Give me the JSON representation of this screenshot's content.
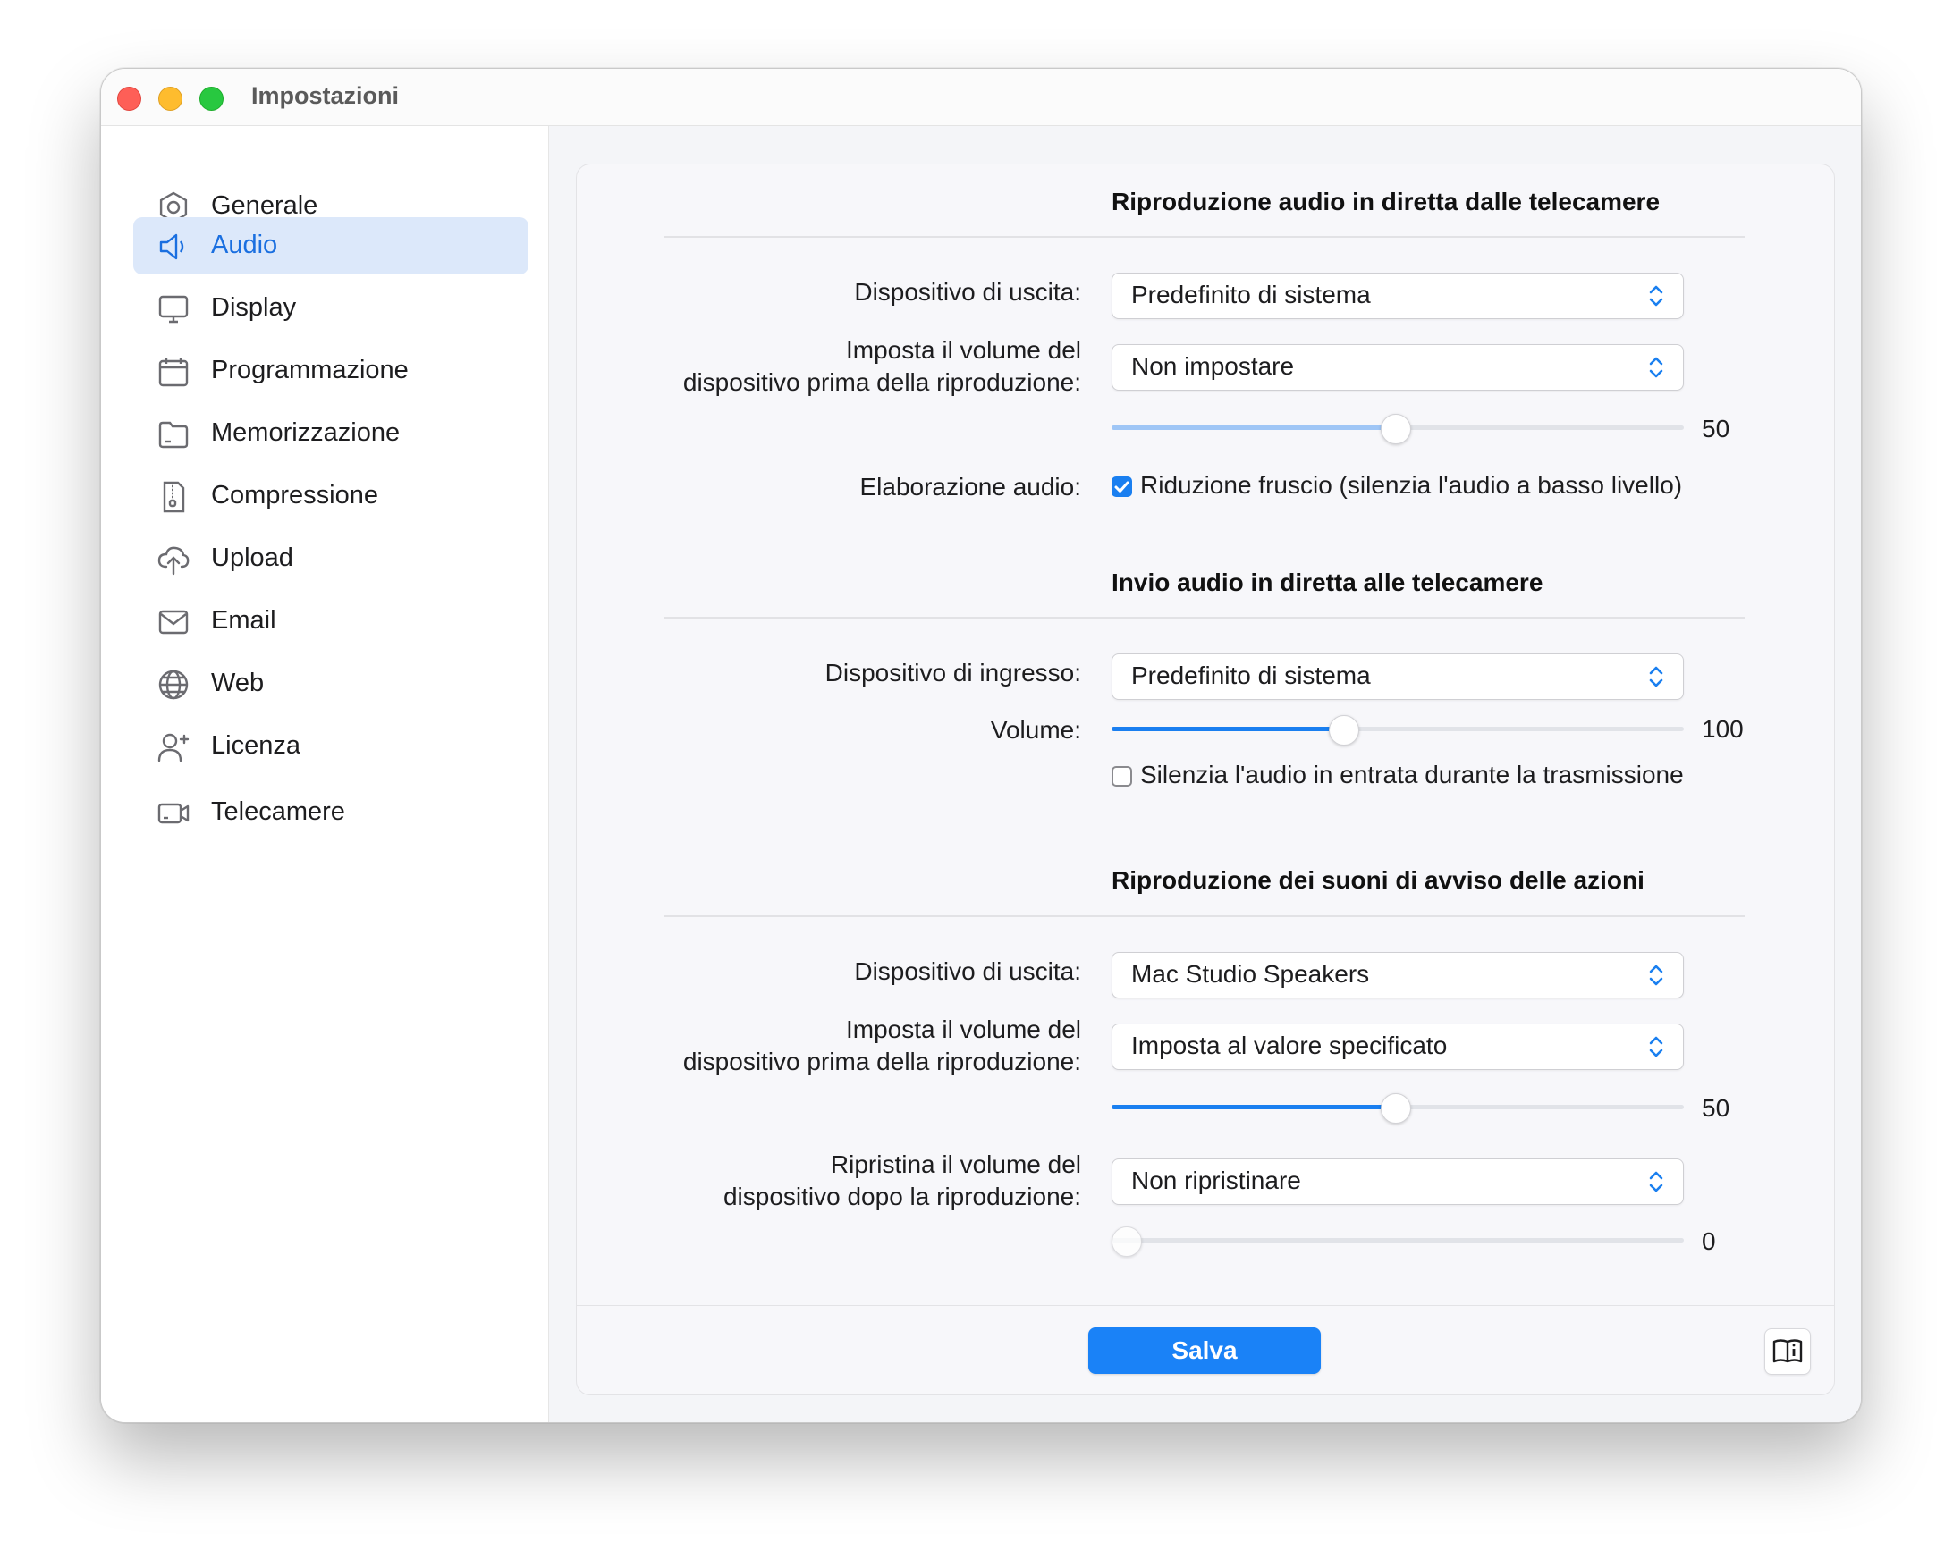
{
  "window": {
    "title": "Impostazioni"
  },
  "sidebar": {
    "items": [
      {
        "label": "Generale",
        "icon": "gear-icon",
        "active": false
      },
      {
        "label": "Audio",
        "icon": "speaker-icon",
        "active": true
      },
      {
        "label": "Display",
        "icon": "display-icon",
        "active": false
      },
      {
        "label": "Programmazione",
        "icon": "calendar-icon",
        "active": false
      },
      {
        "label": "Memorizzazione",
        "icon": "folder-icon",
        "active": false
      },
      {
        "label": "Compressione",
        "icon": "zip-file-icon",
        "active": false
      },
      {
        "label": "Upload",
        "icon": "cloud-upload-icon",
        "active": false
      },
      {
        "label": "Email",
        "icon": "envelope-icon",
        "active": false
      },
      {
        "label": "Web",
        "icon": "globe-icon",
        "active": false
      },
      {
        "label": "Licenza",
        "icon": "person-add-icon",
        "active": false
      },
      {
        "label": "Telecamere",
        "icon": "video-camera-icon",
        "active": false
      }
    ]
  },
  "playback": {
    "title": "Riproduzione audio in diretta dalle telecamere",
    "output_label": "Dispositivo di uscita:",
    "output_value": "Predefinito di sistema",
    "volume_label_line1": "Imposta il volume del",
    "volume_label_line2": "dispositivo prima della riproduzione:",
    "volume_mode": "Non impostare",
    "volume_value": "50",
    "volume_level": 50,
    "volume_disabled": true,
    "processing_label": "Elaborazione audio:",
    "noise_reduction_label": "Riduzione fruscio (silenzia l'audio a basso livello)",
    "noise_reduction_checked": true
  },
  "send": {
    "title": "Invio audio in diretta alle telecamere",
    "input_label": "Dispositivo di ingresso:",
    "input_value": "Predefinito di sistema",
    "volume_label": "Volume:",
    "volume_value": "100",
    "volume_fraction": 0.405,
    "mute_label": "Silenzia l'audio in entrata durante la trasmissione",
    "mute_checked": false
  },
  "alerts": {
    "title": "Riproduzione dei suoni di avviso delle azioni",
    "output_label": "Dispositivo di uscita:",
    "output_value": "Mac Studio Speakers",
    "volume_label_line1": "Imposta il volume del",
    "volume_label_line2": "dispositivo prima della riproduzione:",
    "volume_mode": "Imposta al valore specificato",
    "volume_value": "50",
    "volume_level": 50,
    "restore_label_line1": "Ripristina il volume del",
    "restore_label_line2": "dispositivo dopo la riproduzione:",
    "restore_mode": "Non ripristinare",
    "restore_value": "0",
    "restore_level": 0,
    "restore_disabled": true
  },
  "footer": {
    "save_label": "Salva",
    "help_icon": "book-info-icon"
  },
  "colors": {
    "accent": "#1a82f7",
    "sidebar_active_bg": "#dce8fa",
    "sidebar_active_text": "#1a6fe0"
  }
}
